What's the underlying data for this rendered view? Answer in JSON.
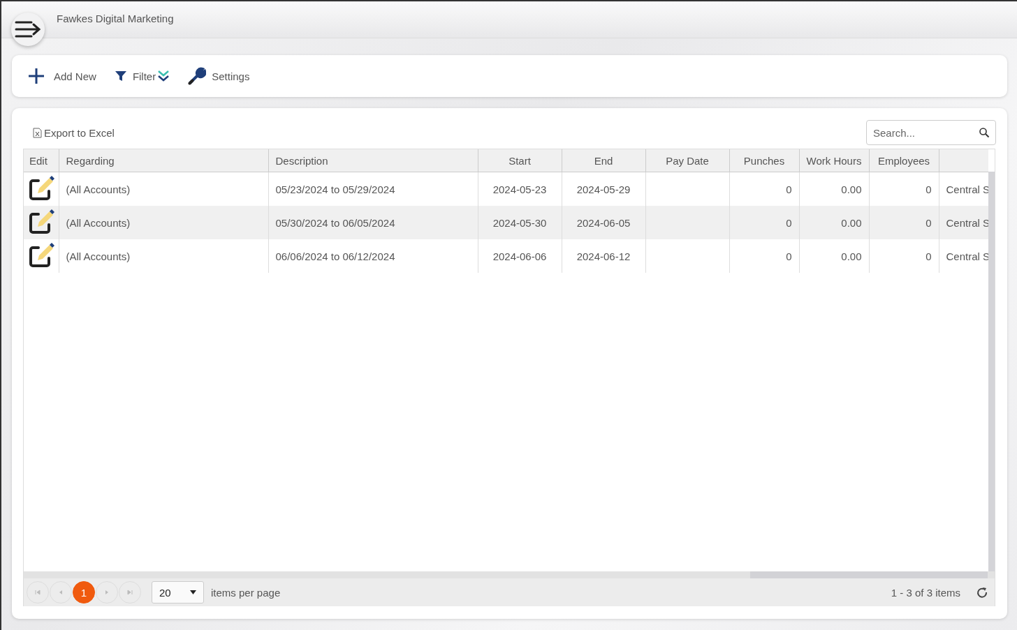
{
  "header": {
    "title": "Fawkes Digital Marketing"
  },
  "toolbar": [
    {
      "kind": "add",
      "label": "Add New"
    },
    {
      "kind": "filter",
      "label": "Filter"
    },
    {
      "kind": "settings",
      "label": "Settings"
    }
  ],
  "grid": {
    "export_label": "Export to Excel",
    "search": {
      "placeholder": "Search..."
    },
    "columns": [
      "Edit",
      "Regarding",
      "Description",
      "Start",
      "End",
      "Pay Date",
      "Punches",
      "Work Hours",
      "Employees"
    ],
    "rows": [
      {
        "cells": [
          "",
          "(All Accounts)",
          "05/23/2024 to 05/29/2024",
          "2024-05-23",
          "2024-05-29",
          "",
          "0",
          "0.00",
          "0",
          "Central S"
        ]
      },
      {
        "cells": [
          "",
          "(All Accounts)",
          "05/30/2024 to 06/05/2024",
          "2024-05-30",
          "2024-06-05",
          "",
          "0",
          "0.00",
          "0",
          "Central S"
        ]
      },
      {
        "cells": [
          "",
          "(All Accounts)",
          "06/06/2024 to 06/12/2024",
          "2024-06-06",
          "2024-06-12",
          "",
          "0",
          "0.00",
          "0",
          "Central S"
        ]
      }
    ],
    "pager": {
      "nav": [
        {
          "kind": "first",
          "disabled": true
        },
        {
          "kind": "prev",
          "disabled": true
        },
        {
          "kind": "page",
          "label": "1",
          "selected": true
        },
        {
          "kind": "next",
          "disabled": true
        },
        {
          "kind": "last",
          "disabled": true
        }
      ],
      "page_size": "20",
      "page_size_label": "items per page",
      "info": "1 - 3 of 3 items"
    }
  }
}
